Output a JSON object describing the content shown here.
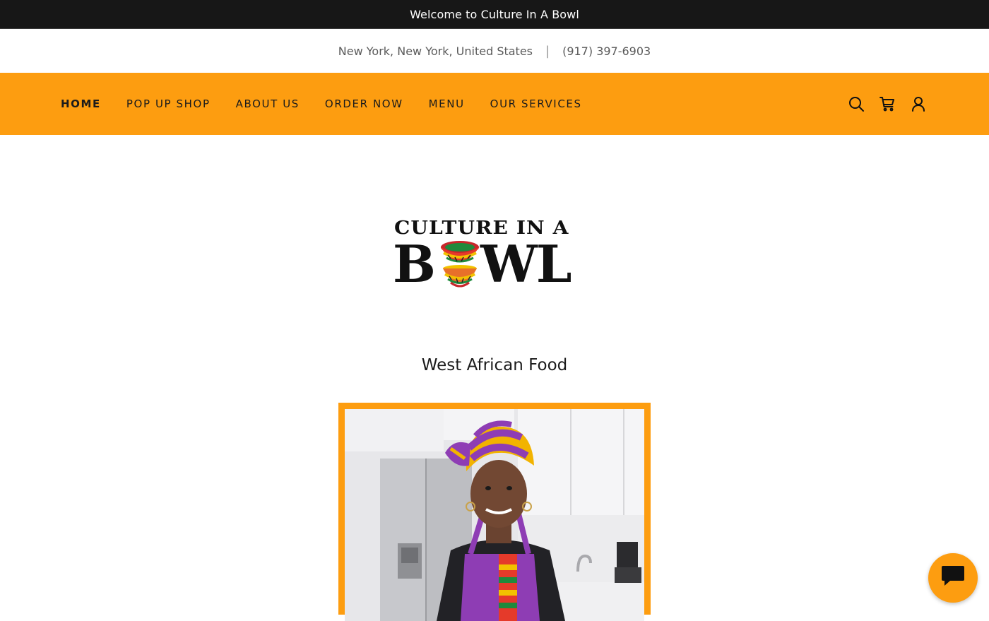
{
  "announcement": "Welcome to Culture In A Bowl",
  "contact": {
    "location": "New York, New York, United States",
    "separator": "|",
    "phone": "(917) 397-6903"
  },
  "nav": {
    "items": [
      {
        "label": "HOME",
        "active": true
      },
      {
        "label": "POP UP SHOP",
        "active": false
      },
      {
        "label": "ABOUT US",
        "active": false
      },
      {
        "label": "ORDER NOW",
        "active": false
      },
      {
        "label": "MENU",
        "active": false
      },
      {
        "label": "OUR SERVICES",
        "active": false
      }
    ],
    "icons": [
      "search-icon",
      "cart-icon",
      "account-icon"
    ]
  },
  "logo": {
    "line1": "CULTURE IN A",
    "line2_b": "B",
    "line2_rest": "WL"
  },
  "hero": {
    "tagline": "West African Food"
  },
  "chat": {
    "icon": "chat-icon"
  },
  "colors": {
    "accent": "#fd9d10",
    "topbar": "#171717",
    "text": "#1b1b1b",
    "muted": "#5a5a5a"
  }
}
